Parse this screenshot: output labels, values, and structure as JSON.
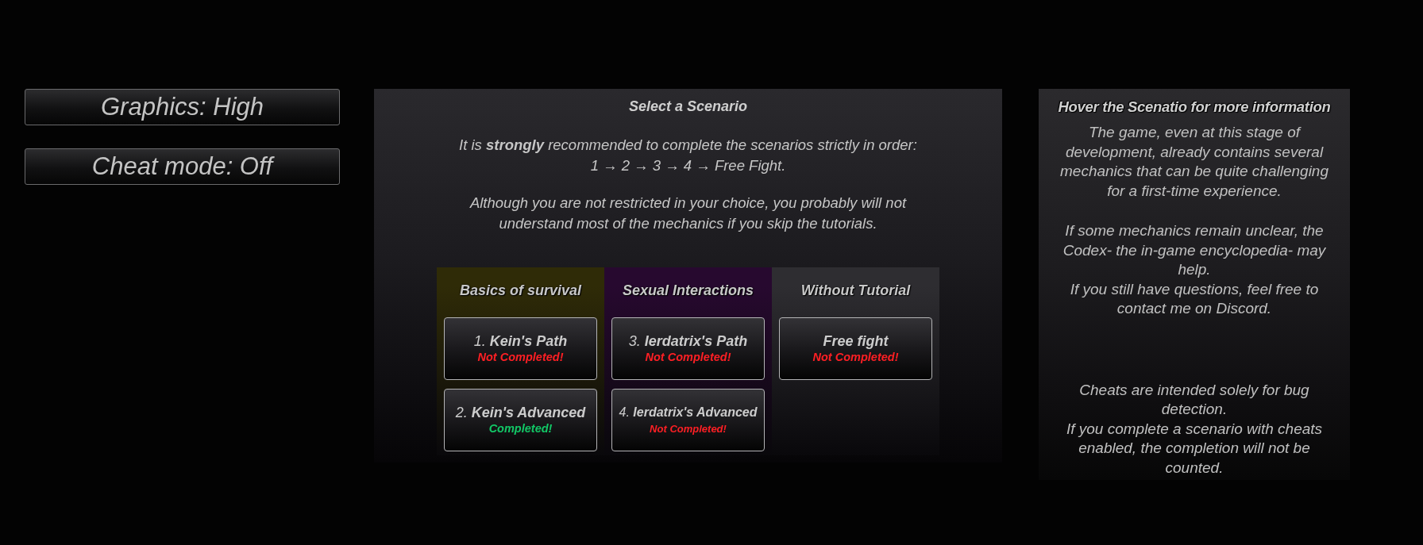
{
  "settings_buttons": [
    {
      "label": "Graphics: High"
    },
    {
      "label": "Cheat mode: Off"
    }
  ],
  "scenario_panel": {
    "title": "Select a Scenario",
    "intro": [
      "It is **strongly** recommended to complete the scenarios strictly in order:",
      "1 → 2 → 3 → 4 → Free Fight."
    ],
    "note": "Although you are not restricted in your choice, you probably will not understand most of the mechanics if you skip the tutorials.",
    "columns": [
      {
        "title": "Basics of survival",
        "color": "#2f2b07",
        "scenarios": [
          {
            "number": "1.",
            "title": "Kein's Path",
            "status": "Not Completed!",
            "completed": false
          },
          {
            "number": "2.",
            "title": "Kein's Advanced",
            "status": "Completed!",
            "completed": true
          }
        ]
      },
      {
        "title": "Sexual Interactions",
        "color": "#27092f",
        "scenarios": [
          {
            "number": "3.",
            "title": "Ierdatrix's Path",
            "status": "Not Completed!",
            "completed": false
          },
          {
            "number": "4.",
            "title": "Ierdatrix's Advanced",
            "status": "Not Completed!",
            "completed": false
          }
        ]
      },
      {
        "title": "Without Tutorial",
        "color": "#2e2d31",
        "scenarios": [
          {
            "title": "Free fight",
            "status": "Not Completed!",
            "completed": false
          }
        ]
      }
    ]
  },
  "info_panel": {
    "title": "Hover the Scenatio for more information",
    "sections": [
      {
        "paragraphs": [
          "The game, even at this stage of development, already contains several mechanics that can be quite challenging for a first-time experience."
        ]
      },
      {
        "paragraphs": [
          "If some mechanics remain unclear, the Codex- the in-game encyclopedia- may help.",
          "If you still have questions, feel free to contact me on Discord."
        ]
      },
      {
        "paragraphs": [
          "Cheats are intended solely for bug detection.",
          "If you complete a scenario with cheats enabled, the completion will not be counted."
        ]
      }
    ]
  }
}
